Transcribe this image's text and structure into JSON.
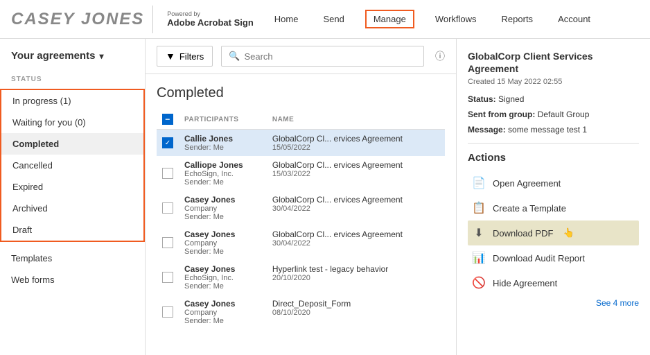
{
  "header": {
    "logo_name": "CASEY JONES",
    "powered_by": "Powered by",
    "adobe_sign": "Adobe Acrobat Sign",
    "nav": [
      {
        "label": "Home",
        "active": false
      },
      {
        "label": "Send",
        "active": false
      },
      {
        "label": "Manage",
        "active": true
      },
      {
        "label": "Workflows",
        "active": false
      },
      {
        "label": "Reports",
        "active": false
      },
      {
        "label": "Account",
        "active": false
      }
    ]
  },
  "sidebar": {
    "agreements_label": "Your agreements",
    "status_label": "STATUS",
    "items": [
      {
        "label": "In progress (1)",
        "id": "in-progress"
      },
      {
        "label": "Waiting for you (0)",
        "id": "waiting"
      },
      {
        "label": "Completed",
        "id": "completed",
        "selected": true
      },
      {
        "label": "Cancelled",
        "id": "cancelled"
      },
      {
        "label": "Expired",
        "id": "expired"
      },
      {
        "label": "Archived",
        "id": "archived"
      },
      {
        "label": "Draft",
        "id": "draft"
      }
    ],
    "templates_label": "Templates",
    "webforms_label": "Web forms"
  },
  "toolbar": {
    "filter_label": "Filters",
    "search_placeholder": "Search"
  },
  "list": {
    "title": "Completed",
    "columns": [
      "",
      "PARTICIPANTS",
      "NAME"
    ],
    "rows": [
      {
        "selected": true,
        "participants": "Callie Jones",
        "sender": "Sender: Me",
        "name": "GlobalCorp Cl... ervices Agreement",
        "date": "15/05/2022"
      },
      {
        "selected": false,
        "participants": "Calliope Jones\nEchoSign, Inc.",
        "sender": "Sender: Me",
        "name": "GlobalCorp Cl... ervices Agreement",
        "date": "15/03/2022"
      },
      {
        "selected": false,
        "participants": "Casey Jones\nCompany",
        "sender": "Sender: Me",
        "name": "GlobalCorp Cl... ervices Agreement",
        "date": "30/04/2022"
      },
      {
        "selected": false,
        "participants": "Casey Jones\nCompany",
        "sender": "Sender: Me",
        "name": "GlobalCorp Cl... ervices Agreement",
        "date": "30/04/2022"
      },
      {
        "selected": false,
        "participants": "Casey Jones\nEchoSign, Inc.",
        "sender": "Sender: Me",
        "name": "Hyperlink test - legacy behavior",
        "date": "20/10/2020"
      },
      {
        "selected": false,
        "participants": "Casey Jones\nCompany",
        "sender": "Sender: Me",
        "name": "Direct_Deposit_Form",
        "date": "08/10/2020"
      }
    ]
  },
  "right_panel": {
    "title": "GlobalCorp Client Services Agreement",
    "created": "Created 15 May 2022 02:55",
    "status_label": "Status:",
    "status_value": "Signed",
    "sent_from_label": "Sent from group:",
    "sent_from_value": "Default Group",
    "message_label": "Message:",
    "message_value": "some message test 1",
    "actions_title": "Actions",
    "actions": [
      {
        "label": "Open Agreement",
        "icon": "doc-icon"
      },
      {
        "label": "Create a Template",
        "icon": "template-icon"
      },
      {
        "label": "Download PDF",
        "icon": "download-pdf-icon",
        "highlighted": true
      },
      {
        "label": "Download Audit Report",
        "icon": "audit-icon"
      },
      {
        "label": "Hide Agreement",
        "icon": "hide-icon"
      }
    ],
    "see_more": "See 4 more"
  }
}
